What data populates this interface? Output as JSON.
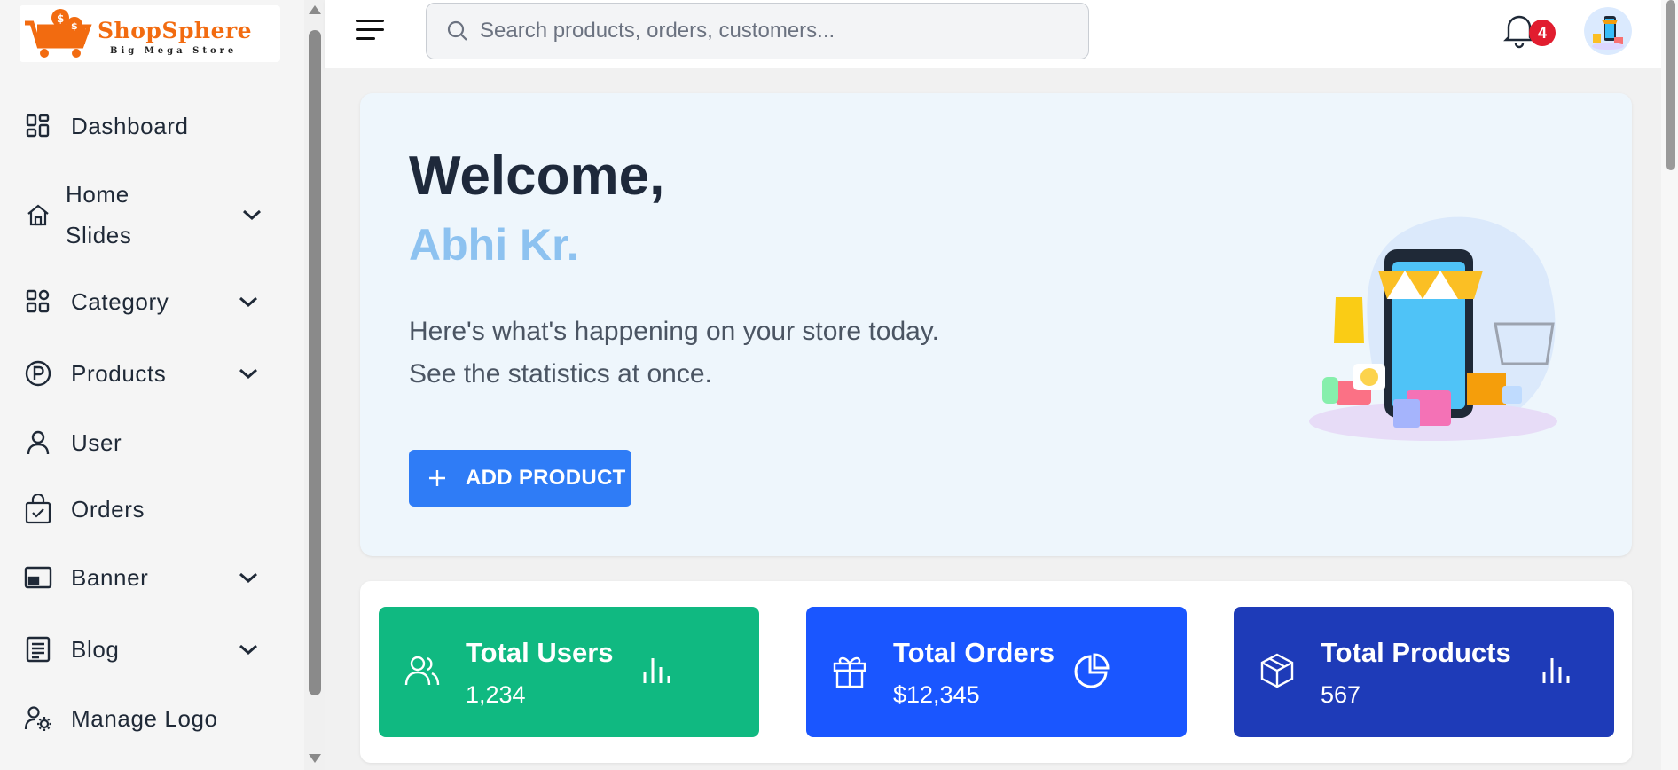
{
  "brand": {
    "name": "ShopSphere",
    "tagline": "Big Mega Store"
  },
  "sidebar": {
    "items": [
      {
        "label": "Dashboard",
        "icon": "dashboard-icon",
        "expandable": false
      },
      {
        "label_line1": "Home",
        "label_line2": "Slides",
        "icon": "home-icon",
        "expandable": true
      },
      {
        "label": "Category",
        "icon": "category-icon",
        "expandable": true
      },
      {
        "label": "Products",
        "icon": "products-icon",
        "expandable": true
      },
      {
        "label": "User",
        "icon": "user-icon",
        "expandable": false
      },
      {
        "label": "Orders",
        "icon": "orders-bag-icon",
        "expandable": false
      },
      {
        "label": "Banner",
        "icon": "banner-icon",
        "expandable": true
      },
      {
        "label": "Blog",
        "icon": "blog-icon",
        "expandable": true
      },
      {
        "label": "Manage Logo",
        "icon": "manage-logo-icon",
        "expandable": false
      }
    ]
  },
  "header": {
    "search_placeholder": "Search products, orders, customers...",
    "notification_count": "4"
  },
  "hero": {
    "title": "Welcome,",
    "name": "Abhi Kr.",
    "line1": "Here's what's happening on your store today.",
    "line2": "See the statistics at once.",
    "button_label": "ADD PRODUCT"
  },
  "stats": [
    {
      "title": "Total Users",
      "value": "1,234",
      "color": "#10b981",
      "icon": "users-icon",
      "side_icon": "bar-chart-icon"
    },
    {
      "title": "Total Orders",
      "value": "$12,345",
      "color": "#1a56ff",
      "icon": "gift-icon",
      "side_icon": "pie-chart-icon"
    },
    {
      "title": "Total Products",
      "value": "567",
      "color": "#1e3bb8",
      "icon": "box-icon",
      "side_icon": "bar-chart-icon"
    }
  ],
  "colors": {
    "primary_button": "#2f7cf6",
    "hero_bg": "#eef6fc",
    "name_accent": "#8dc2f0",
    "badge": "#e11d2f"
  }
}
